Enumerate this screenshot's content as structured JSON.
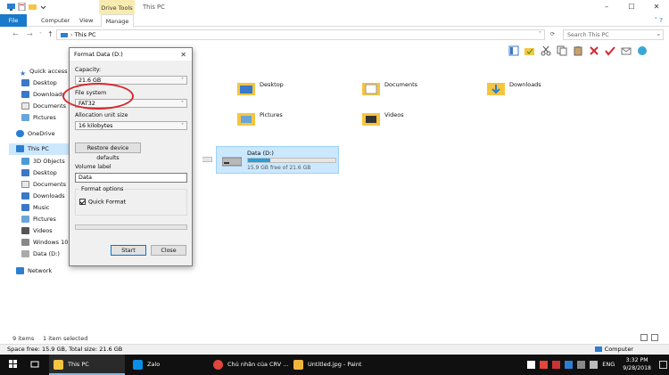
{
  "window": {
    "title": "This PC",
    "context_tab": "Drive Tools"
  },
  "ribbon": {
    "tabs": [
      "File",
      "Computer",
      "View",
      "Manage"
    ]
  },
  "address": {
    "path": "This PC",
    "search_placeholder": "Search This PC"
  },
  "nav": {
    "items": [
      "Quick access",
      "Desktop",
      "Downloads",
      "Documents",
      "Pictures",
      "OneDrive",
      "This PC",
      "3D Objects",
      "Desktop",
      "Documents",
      "Downloads",
      "Music",
      "Pictures",
      "Videos",
      "Windows 10 (",
      "Data (D:)",
      "Network"
    ]
  },
  "content": {
    "folders": [
      "Desktop",
      "Documents",
      "Downloads",
      "Pictures",
      "Videos"
    ],
    "drive": {
      "name": "Data (D:)",
      "free": "15.9 GB free of 21.6 GB",
      "used_fraction": 0.26
    }
  },
  "status": {
    "items": "9 items",
    "selected": "1 item selected",
    "space": "Space free: 15.9 GB, Total size: 21.6 GB",
    "computer": "Computer"
  },
  "dialog": {
    "title": "Format Data (D:)",
    "capacity_label": "Capacity:",
    "capacity_value": "21.6 GB",
    "filesystem_label": "File system",
    "filesystem_value": "FAT32",
    "allocation_label": "Allocation unit size",
    "allocation_value": "16 kilobytes",
    "restore_label": "Restore device defaults",
    "volume_label": "Volume label",
    "volume_value": "Data",
    "format_options": "Format options",
    "quick_format": "Quick Format",
    "start": "Start",
    "close": "Close"
  },
  "taskbar": {
    "items": [
      "This PC",
      "Zalo",
      "Chủ nhân của CRV ...",
      "Untitled.jpg - Paint"
    ],
    "lang": "ENG",
    "time": "3:32 PM",
    "date": "9/28/2018"
  },
  "colors": {
    "accent": "#1979ca",
    "selection": "#cce8ff",
    "annotation": "#d4292e",
    "context_tab": "#f8ebb0"
  }
}
